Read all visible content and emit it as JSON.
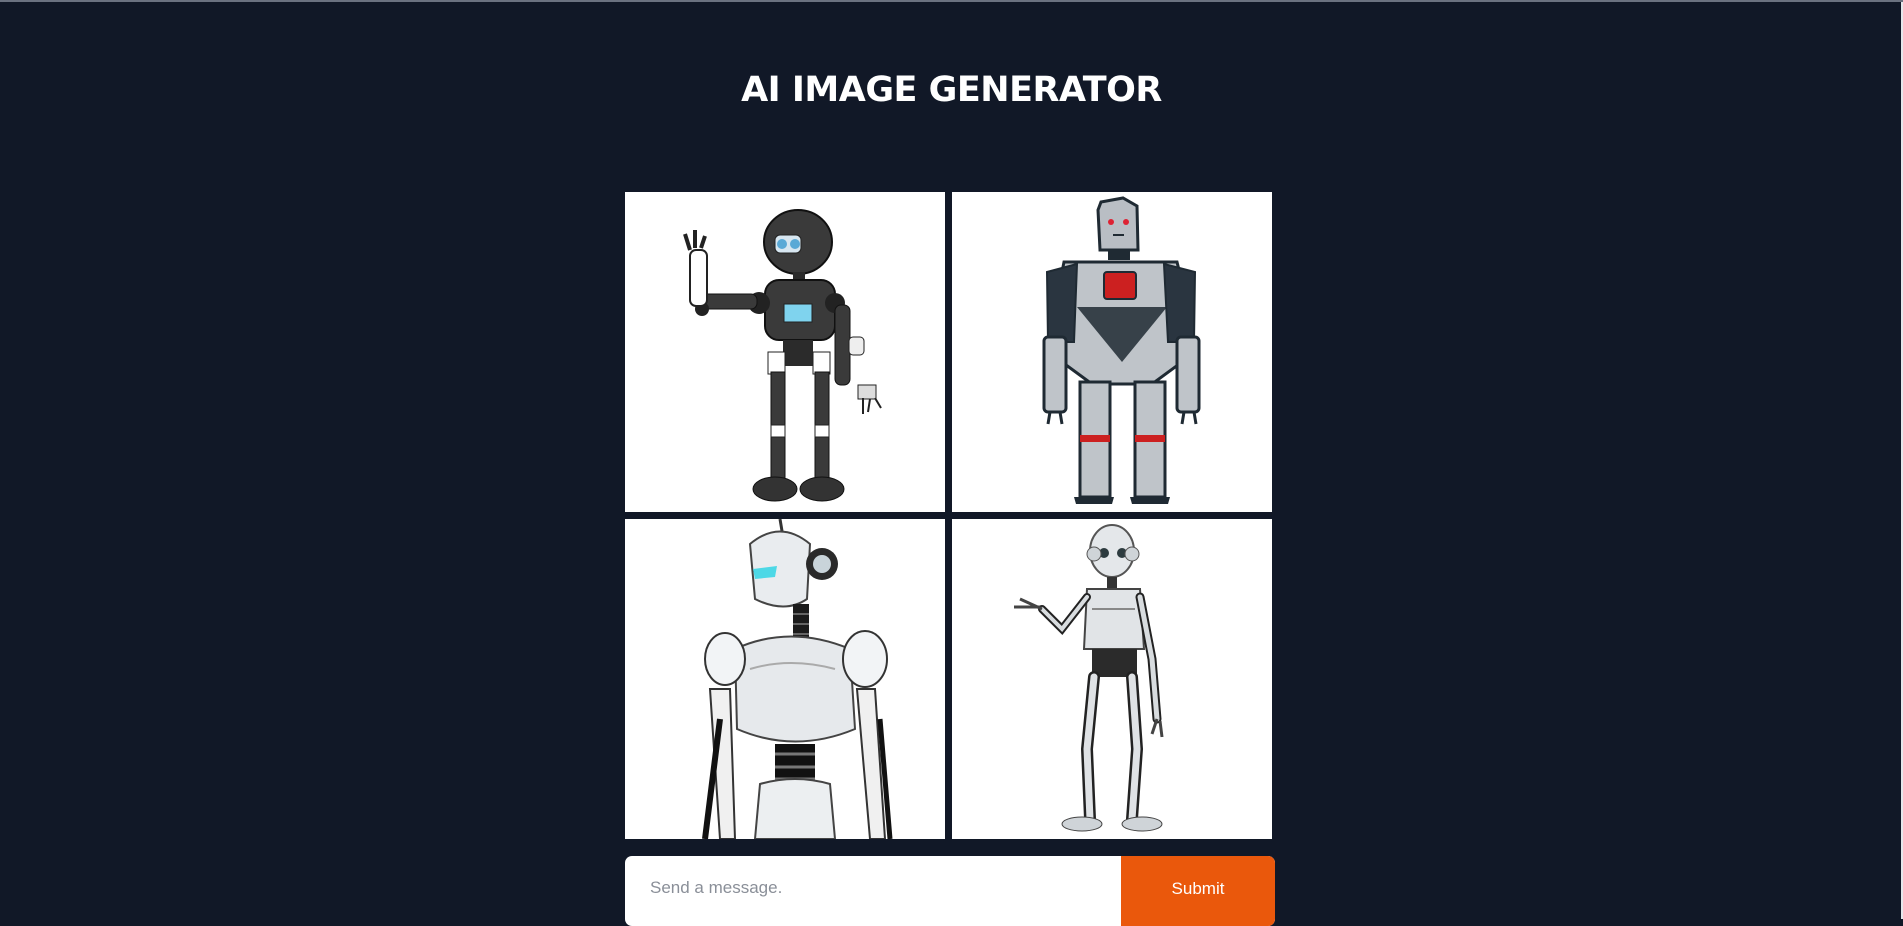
{
  "header": {
    "title": "AI IMAGE GENERATOR"
  },
  "gallery": {
    "images": [
      {
        "subject": "cartoon robot waving"
      },
      {
        "subject": "grey robot with red chest panel"
      },
      {
        "subject": "white humanoid robot close-up"
      },
      {
        "subject": "silver humanoid robot pointing"
      }
    ]
  },
  "prompt": {
    "placeholder": "Send a message.",
    "value": ""
  },
  "submit": {
    "label": "Submit"
  },
  "colors": {
    "background": "#111827",
    "accent": "#ea580c",
    "title": "#ffffff"
  }
}
